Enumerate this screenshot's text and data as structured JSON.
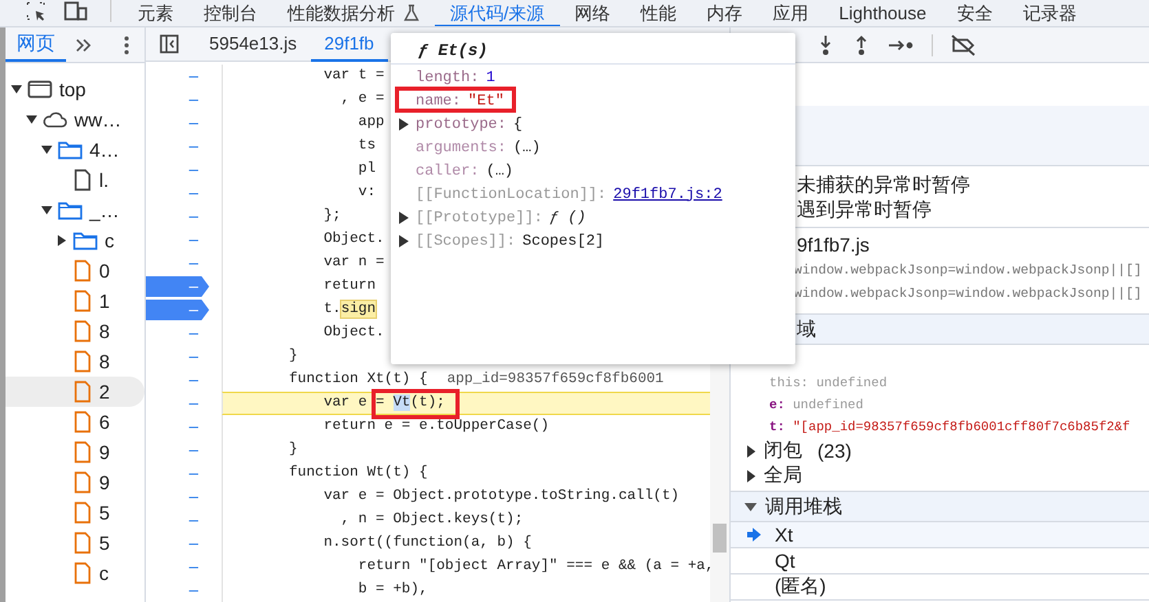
{
  "panel_tabs": [
    {
      "label": "元素",
      "selected": false,
      "kind": "plain"
    },
    {
      "label": "控制台",
      "selected": false,
      "kind": "plain"
    },
    {
      "label": "性能数据分析",
      "selected": false,
      "kind": "experimental"
    },
    {
      "label": "源代码/来源",
      "selected": true,
      "kind": "plain"
    },
    {
      "label": "网络",
      "selected": false,
      "kind": "plain"
    },
    {
      "label": "性能",
      "selected": false,
      "kind": "plain"
    },
    {
      "label": "内存",
      "selected": false,
      "kind": "plain"
    },
    {
      "label": "应用",
      "selected": false,
      "kind": "plain"
    },
    {
      "label": "Lighthouse",
      "selected": false,
      "kind": "plain"
    },
    {
      "label": "安全",
      "selected": false,
      "kind": "plain"
    },
    {
      "label": "记录器",
      "selected": false,
      "kind": "plain"
    }
  ],
  "navigator": {
    "tabs": [
      {
        "label": "网页",
        "selected": true
      }
    ],
    "tree": [
      {
        "label": "top",
        "kind": "frame",
        "expanded": true,
        "selected": false,
        "children": [
          {
            "label": "ww…",
            "kind": "origin",
            "expanded": true,
            "selected": false,
            "children": [
              {
                "label": "4…",
                "kind": "folder",
                "expanded": true,
                "selected": false,
                "children": [
                  {
                    "label": "l.",
                    "kind": "document",
                    "selected": false
                  }
                ]
              },
              {
                "label": "_…",
                "kind": "folder",
                "expanded": true,
                "selected": false,
                "children": [
                  {
                    "label": "c",
                    "kind": "folder",
                    "expanded": false,
                    "selected": false
                  },
                  {
                    "label": "0",
                    "kind": "script",
                    "selected": false
                  },
                  {
                    "label": "1",
                    "kind": "script",
                    "selected": false
                  },
                  {
                    "label": "8",
                    "kind": "script",
                    "selected": false
                  },
                  {
                    "label": "8",
                    "kind": "script",
                    "selected": false
                  },
                  {
                    "label": "2",
                    "kind": "script",
                    "selected": true
                  },
                  {
                    "label": "6",
                    "kind": "script",
                    "selected": false
                  },
                  {
                    "label": "9",
                    "kind": "script",
                    "selected": false
                  },
                  {
                    "label": "9",
                    "kind": "script",
                    "selected": false
                  },
                  {
                    "label": "5",
                    "kind": "script",
                    "selected": false
                  },
                  {
                    "label": "5",
                    "kind": "script",
                    "selected": false
                  },
                  {
                    "label": "c",
                    "kind": "script",
                    "selected": false
                  }
                ]
              }
            ]
          }
        ]
      }
    ]
  },
  "editor": {
    "tabs": [
      {
        "label": "5954e13.js",
        "selected": false
      },
      {
        "label": "29f1fb",
        "selected": true
      }
    ],
    "lines": [
      {
        "gutter": "–",
        "breakpoint": false,
        "paused": false,
        "text": "    var t ="
      },
      {
        "gutter": "–",
        "breakpoint": false,
        "paused": false,
        "text": "      , e ="
      },
      {
        "gutter": "–",
        "breakpoint": false,
        "paused": false,
        "text": "        app"
      },
      {
        "gutter": "–",
        "breakpoint": false,
        "paused": false,
        "text": "        ts"
      },
      {
        "gutter": "–",
        "breakpoint": false,
        "paused": false,
        "text": "        pl"
      },
      {
        "gutter": "–",
        "breakpoint": false,
        "paused": false,
        "text": "        v:"
      },
      {
        "gutter": "–",
        "breakpoint": false,
        "paused": false,
        "text": "    };"
      },
      {
        "gutter": "–",
        "breakpoint": false,
        "paused": false,
        "text": "    Object."
      },
      {
        "gutter": "–",
        "breakpoint": false,
        "paused": false,
        "text": "    var n ="
      },
      {
        "gutter": "–",
        "breakpoint": true,
        "paused": false,
        "text": "    return"
      },
      {
        "gutter": "–",
        "breakpoint": true,
        "paused": false,
        "text": "    t.",
        "highlight": {
          "text": "sign",
          "kind": "search_hit"
        }
      },
      {
        "gutter": "–",
        "breakpoint": false,
        "paused": false,
        "text": "    Object."
      },
      {
        "gutter": "–",
        "breakpoint": false,
        "paused": false,
        "text": "}"
      },
      {
        "gutter": "–",
        "breakpoint": false,
        "paused": false,
        "text": "function Xt(t) {",
        "inline_value": "app_id=98357f659cf8fb6001"
      },
      {
        "gutter": "–",
        "breakpoint": false,
        "paused": true,
        "text": "    var e = ",
        "highlight": {
          "text": "Vt",
          "kind": "selection"
        },
        "after": "(t);"
      },
      {
        "gutter": "–",
        "breakpoint": false,
        "paused": false,
        "text": "    return e = e.toUpperCase()"
      },
      {
        "gutter": "–",
        "breakpoint": false,
        "paused": false,
        "text": "}"
      },
      {
        "gutter": "–",
        "breakpoint": false,
        "paused": false,
        "text": "function Wt(t) {"
      },
      {
        "gutter": "–",
        "breakpoint": false,
        "paused": false,
        "text": "    var e = Object.prototype.toString.call(t)"
      },
      {
        "gutter": "–",
        "breakpoint": false,
        "paused": false,
        "text": "      , n = Object.keys(t);"
      },
      {
        "gutter": "–",
        "breakpoint": false,
        "paused": false,
        "text": "    n.sort((function(a, b) {"
      },
      {
        "gutter": "–",
        "breakpoint": false,
        "paused": false,
        "text": "        return \"[object Array]\" === e && (a = +a,"
      },
      {
        "gutter": "–",
        "breakpoint": false,
        "paused": false,
        "text": "        b = +b),"
      }
    ]
  },
  "popover": {
    "title": "ƒ Et(s)",
    "properties": [
      {
        "key": "length:",
        "value": "1",
        "kind": "number",
        "expandable": false
      },
      {
        "key": "name:",
        "value": "\"Et\"",
        "kind": "string",
        "expandable": false
      },
      {
        "key": "prototype:",
        "value": "{",
        "kind": "object",
        "expandable": true
      },
      {
        "key": "arguments:",
        "value": "(…)",
        "kind": "accessor",
        "expandable": false
      },
      {
        "key": "caller:",
        "value": "(…)",
        "kind": "accessor",
        "expandable": false
      },
      {
        "key": "[[FunctionLocation]]:",
        "value": "29f1fb7.js:2",
        "kind": "internal_link",
        "expandable": false
      },
      {
        "key": "[[Prototype]]:",
        "value": "ƒ ()",
        "kind": "internal_function",
        "expandable": true
      },
      {
        "key": "[[Scopes]]:",
        "value": "Scopes[2]",
        "kind": "internal",
        "expandable": true
      }
    ]
  },
  "debugger": {
    "exception_options": [
      "未捕获的异常时暂停",
      "遇到异常时暂停"
    ],
    "breakpoint_file": "9f1fb7.js",
    "breakpoint_snippets": [
      "window.webpackJsonp=window.webpackJsonp||[]",
      "window.webpackJsonp=window.webpackJsonp||[]"
    ],
    "scope": {
      "title": "域",
      "variables": [
        {
          "name": "this:",
          "value": "undefined",
          "kind": "receiver"
        },
        {
          "name": "e:",
          "value": "undefined",
          "kind": "unset"
        },
        {
          "name": "t:",
          "value": "\"[app_id=98357f659cf8fb6001cff80f7c6b85f2&f",
          "kind": "string"
        }
      ],
      "groups": [
        {
          "label": "闭包",
          "count": "(23)",
          "expanded": false
        },
        {
          "label": "全局",
          "expanded": false
        }
      ]
    },
    "call_stack": {
      "title": "调用堆栈",
      "expanded": true,
      "frames": [
        {
          "name": "Xt",
          "selected": true
        },
        {
          "name": "Qt",
          "selected": false
        },
        {
          "name": "(匿名)",
          "selected": false
        }
      ]
    }
  }
}
